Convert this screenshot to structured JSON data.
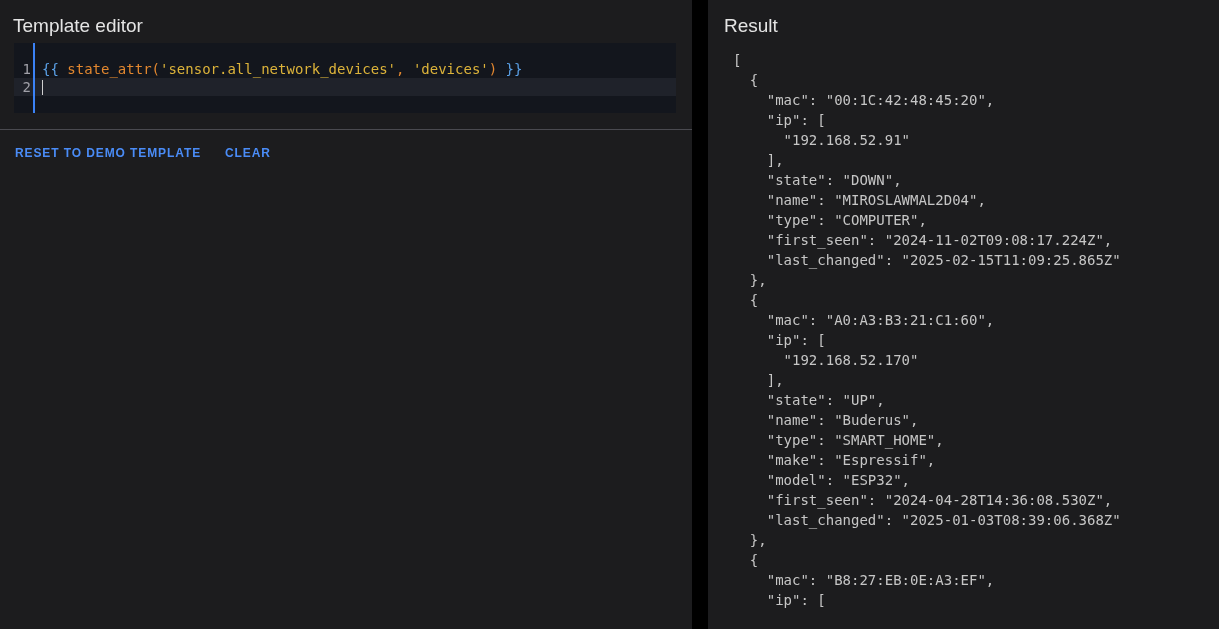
{
  "editor": {
    "title": "Template editor",
    "lines": [
      {
        "number": "1",
        "active": false,
        "tokens": [
          {
            "kind": "delimiter",
            "text": "{{ "
          },
          {
            "kind": "function",
            "text": "state_attr("
          },
          {
            "kind": "string",
            "text": "'sensor.all_network_devices'"
          },
          {
            "kind": "function",
            "text": ", "
          },
          {
            "kind": "string",
            "text": "'devices'"
          },
          {
            "kind": "function",
            "text": ") "
          },
          {
            "kind": "delimiter",
            "text": "}}"
          }
        ]
      },
      {
        "number": "2",
        "active": true
      }
    ],
    "buttons": [
      "RESET TO DEMO TEMPLATE",
      "CLEAR"
    ]
  },
  "result": {
    "title": "Result",
    "lines": [
      "[",
      "  {",
      "    \"mac\": \"00:1C:42:48:45:20\",",
      "    \"ip\": [",
      "      \"192.168.52.91\"",
      "    ],",
      "    \"state\": \"DOWN\",",
      "    \"name\": \"MIROSLAWMAL2D04\",",
      "    \"type\": \"COMPUTER\",",
      "    \"first_seen\": \"2024-11-02T09:08:17.224Z\",",
      "    \"last_changed\": \"2025-02-15T11:09:25.865Z\"",
      "  },",
      "  {",
      "    \"mac\": \"A0:A3:B3:21:C1:60\",",
      "    \"ip\": [",
      "      \"192.168.52.170\"",
      "    ],",
      "    \"state\": \"UP\",",
      "    \"name\": \"Buderus\",",
      "    \"type\": \"SMART_HOME\",",
      "    \"make\": \"Espressif\",",
      "    \"model\": \"ESP32\",",
      "    \"first_seen\": \"2024-04-28T14:36:08.530Z\",",
      "    \"last_changed\": \"2025-01-03T08:39:06.368Z\"",
      "  },",
      "  {",
      "    \"mac\": \"B8:27:EB:0E:A3:EF\",",
      "    \"ip\": ["
    ]
  }
}
